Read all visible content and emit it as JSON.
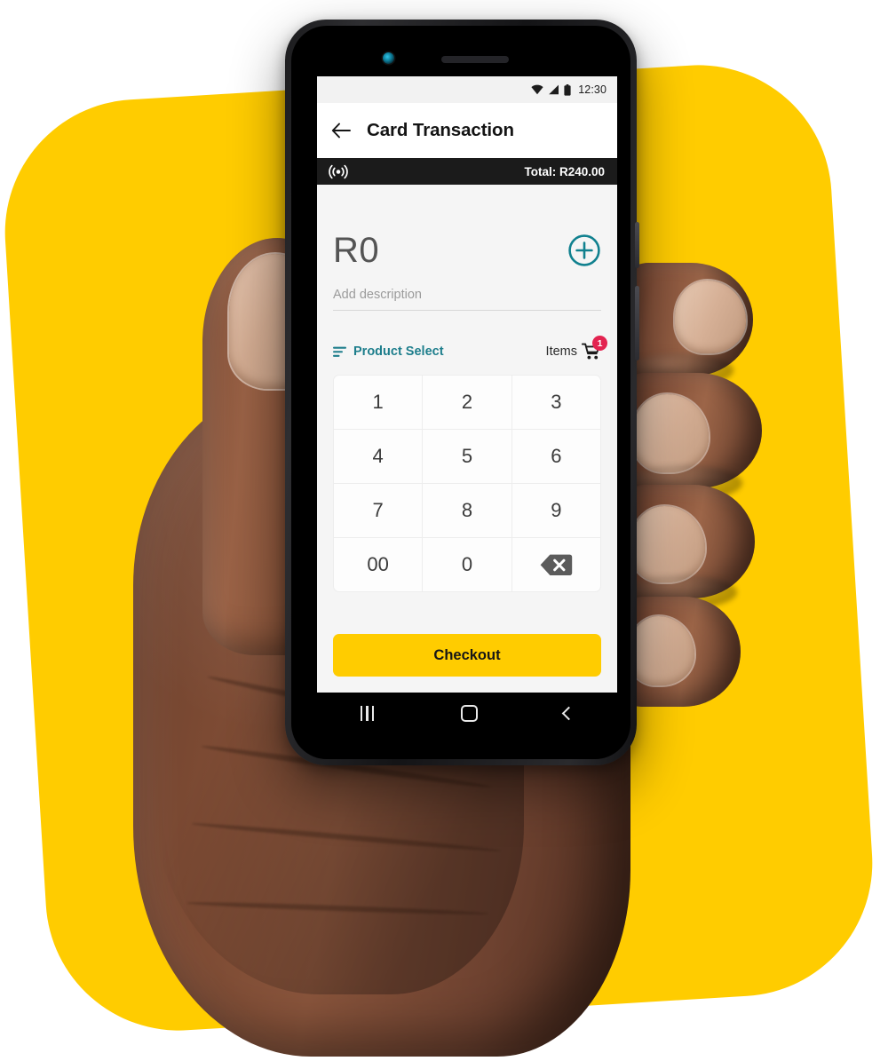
{
  "scene": {
    "background_color": "#FFFFFF",
    "accent_yellow": "#FFCC00",
    "accent_teal": "#1E7E8C",
    "badge_red": "#E32350",
    "description": "hand-holding-phone-mockup"
  },
  "phone": {
    "camera_icon": "front-camera",
    "speaker_icon": "earpiece-speaker"
  },
  "status_bar": {
    "wifi_icon": "wifi-icon",
    "signal_icon": "cellular-signal-icon",
    "battery_icon": "battery-icon",
    "time": "12:30"
  },
  "app_bar": {
    "back_icon": "arrow-left-icon",
    "title": "Card Transaction"
  },
  "nfc_bar": {
    "nfc_icon": "contactless-nfc-icon",
    "total": "Total: R240.00"
  },
  "amount_section": {
    "amount": "R0",
    "add_icon": "plus-circle-icon",
    "description_placeholder": "Add description"
  },
  "select_row": {
    "product_select_icon": "sort-list-icon",
    "product_select_label": "Product Select",
    "items_label": "Items",
    "cart_icon": "shopping-cart-icon",
    "cart_count": "1"
  },
  "keypad": {
    "keys": [
      {
        "label": "1",
        "type": "digit"
      },
      {
        "label": "2",
        "type": "digit"
      },
      {
        "label": "3",
        "type": "digit"
      },
      {
        "label": "4",
        "type": "digit"
      },
      {
        "label": "5",
        "type": "digit"
      },
      {
        "label": "6",
        "type": "digit"
      },
      {
        "label": "7",
        "type": "digit"
      },
      {
        "label": "8",
        "type": "digit"
      },
      {
        "label": "9",
        "type": "digit"
      },
      {
        "label": "00",
        "type": "digit"
      },
      {
        "label": "0",
        "type": "digit"
      },
      {
        "label": "",
        "type": "backspace",
        "icon": "backspace-delete-icon"
      }
    ]
  },
  "checkout": {
    "label": "Checkout"
  },
  "nav_bar": {
    "recents_icon": "recents-icon",
    "home_icon": "home-icon",
    "back_icon": "back-icon"
  }
}
